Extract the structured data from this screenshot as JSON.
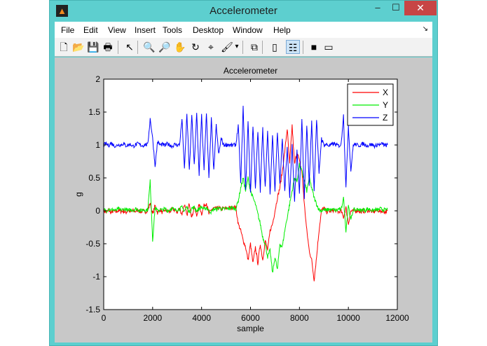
{
  "window": {
    "title": "Accelerometer",
    "minimize": "–",
    "maximize": "☐",
    "close": "✕",
    "app_icon": "matlab-logo"
  },
  "menu": [
    {
      "label": "File"
    },
    {
      "label": "Edit"
    },
    {
      "label": "View"
    },
    {
      "label": "Insert"
    },
    {
      "label": "Tools"
    },
    {
      "label": "Desktop"
    },
    {
      "label": "Window"
    },
    {
      "label": "Help"
    }
  ],
  "toolbar": [
    {
      "icon": "new-figure-icon",
      "glyph": "🗋"
    },
    {
      "icon": "open-icon",
      "glyph": "📂"
    },
    {
      "icon": "save-icon",
      "glyph": "💾"
    },
    {
      "icon": "print-icon",
      "glyph": "🖶"
    },
    {
      "icon": "pointer-icon",
      "glyph": "↖"
    },
    {
      "icon": "zoom-in-icon",
      "glyph": "🔍"
    },
    {
      "icon": "zoom-out-icon",
      "glyph": "🔎"
    },
    {
      "icon": "pan-icon",
      "glyph": "✋"
    },
    {
      "icon": "rotate-3d-icon",
      "glyph": "↻"
    },
    {
      "icon": "data-cursor-icon",
      "glyph": "⌖"
    },
    {
      "icon": "brush-icon",
      "glyph": "🖌"
    },
    {
      "icon": "brush-dropdown-icon",
      "glyph": "▾"
    },
    {
      "icon": "link-plot-icon",
      "glyph": "⧉"
    },
    {
      "icon": "colorbar-icon",
      "glyph": "▯"
    },
    {
      "icon": "legend-icon",
      "glyph": "☷"
    },
    {
      "icon": "hide-plot-tools-icon",
      "glyph": "■"
    },
    {
      "icon": "show-plot-tools-icon",
      "glyph": "▭"
    }
  ],
  "chart_data": {
    "type": "line",
    "title": "Accelerometer",
    "xlabel": "sample",
    "ylabel": "g",
    "xlim": [
      0,
      12000
    ],
    "ylim": [
      -1.5,
      2
    ],
    "xticks": [
      "0",
      "2000",
      "4000",
      "6000",
      "8000",
      "10000",
      "12000"
    ],
    "yticks": [
      "-1.5",
      "-1",
      "-0.5",
      "0",
      "0.5",
      "1",
      "1.5",
      "2"
    ],
    "legend_placement": "top-right",
    "x_step": 100,
    "series": [
      {
        "name": "X",
        "color": "#ff0000",
        "values": [
          0,
          -0.02,
          0.01,
          -0.03,
          0,
          -0.02,
          0.01,
          -0.01,
          0,
          -0.03,
          0.01,
          -0.02,
          0,
          -0.01,
          0.02,
          -0.02,
          0,
          -0.01,
          0,
          0.12,
          -0.05,
          0.08,
          -0.03,
          0.02,
          -0.03,
          0.01,
          0,
          -0.02,
          0.03,
          0.01,
          -0.02,
          0.03,
          -0.05,
          0.1,
          -0.08,
          0.12,
          -0.1,
          0.06,
          -0.08,
          0.1,
          -0.05,
          0.08,
          0.12,
          -0.05,
          0.02,
          0.04,
          0.03,
          0.05,
          0.02,
          0.04,
          0.03,
          0.05,
          0.04,
          0.06,
          0.05,
          -0.2,
          -0.3,
          -0.45,
          -0.55,
          -0.75,
          -0.5,
          -0.8,
          -0.55,
          -0.8,
          -0.5,
          -0.75,
          -0.45,
          -0.6,
          -0.3,
          -0.2,
          0.0,
          0.2,
          0.35,
          0.6,
          0.9,
          1.25,
          0.7,
          1.3,
          0.7,
          0.9,
          0.75,
          0.6,
          0.1,
          -0.3,
          -0.6,
          -0.75,
          -1.05,
          -0.7,
          -0.3,
          0.0,
          0.05,
          -0.02,
          0,
          -0.01,
          0.01,
          0,
          -0.02,
          0,
          -0.1,
          0.05,
          -0.2,
          0,
          -0.01,
          0,
          0.01,
          -0.02,
          0,
          -0.01,
          0.01,
          0,
          -0.02,
          0,
          0.01,
          -0.01,
          0,
          -0.02,
          0
        ]
      },
      {
        "name": "Y",
        "color": "#00ee00",
        "values": [
          0.02,
          0,
          0.03,
          0.01,
          0.02,
          0,
          0.03,
          0.01,
          0.02,
          0.03,
          0,
          0.02,
          0.01,
          0.03,
          0.02,
          0,
          0.02,
          0.01,
          0.02,
          0.45,
          -0.45,
          0.05,
          0,
          0.02,
          0.01,
          0.03,
          0,
          0.02,
          0.04,
          0.01,
          0.02,
          0.03,
          0.05,
          0,
          0.06,
          -0.02,
          0.04,
          0.05,
          0,
          0.03,
          0.06,
          0.02,
          0.05,
          0,
          -0.02,
          0.03,
          0.02,
          0.05,
          0.03,
          0.02,
          0.04,
          0.03,
          0.05,
          0.04,
          0.03,
          0.15,
          0.35,
          0.5,
          0.3,
          0.5,
          0.3,
          0.2,
          0.1,
          -0.05,
          -0.2,
          -0.4,
          -0.5,
          -0.7,
          -0.6,
          -0.95,
          -0.7,
          -0.9,
          -0.5,
          -0.55,
          -0.3,
          -0.1,
          0.1,
          0.3,
          0.5,
          0.45,
          0.7,
          0.6,
          0.45,
          0.3,
          0.5,
          0.35,
          0.2,
          0.1,
          0.02,
          0.0,
          0.02,
          0,
          0.03,
          0.01,
          0.02,
          0,
          0.03,
          0.01,
          0.2,
          -0.3,
          0.1,
          -0.15,
          0.02,
          0.01,
          0.03,
          0,
          0.02,
          0.01,
          0.03,
          0.02,
          0,
          0.02,
          0.01,
          0.03,
          0.02,
          0.01,
          0.02
        ]
      },
      {
        "name": "Z",
        "color": "#0000ff",
        "values": [
          1.0,
          1.02,
          0.99,
          1.03,
          1.0,
          0.98,
          1.01,
          1.0,
          1.02,
          0.99,
          1.0,
          1.01,
          0.98,
          1.0,
          1.02,
          1.0,
          0.99,
          1.01,
          1.0,
          1.4,
          1.1,
          0.68,
          1.05,
          1.0,
          1.01,
          0.99,
          1.02,
          1.0,
          0.98,
          1.01,
          1.0,
          1.0,
          1.4,
          0.62,
          1.48,
          0.6,
          1.45,
          0.7,
          1.48,
          0.55,
          1.45,
          0.62,
          1.5,
          0.48,
          1.4,
          0.6,
          1.3,
          0.85,
          1.1,
          1.0,
          1.0,
          1.01,
          0.99,
          1.0,
          1.0,
          1.3,
          0.4,
          1.58,
          0.3,
          1.35,
          0.25,
          1.3,
          0.35,
          1.2,
          0.3,
          1.25,
          0.35,
          1.2,
          0.25,
          1.15,
          0.3,
          1.2,
          0.4,
          1.1,
          0.3,
          0.95,
          0.2,
          1.0,
          0.15,
          0.9,
          0.25,
          1.38,
          0.2,
          1.3,
          0.4,
          1.35,
          0.3,
          1.4,
          0.55,
          1.1,
          1.0,
          1.01,
          0.99,
          1.0,
          1.02,
          1.0,
          0.99,
          1.0,
          1.45,
          0.35,
          1.3,
          0.6,
          1.0,
          1.01,
          0.99,
          1.0,
          1.02,
          1.0,
          0.99,
          1.01,
          1.0,
          0.98,
          1.01,
          1.0,
          1.02,
          0.99,
          1.0
        ]
      }
    ]
  }
}
